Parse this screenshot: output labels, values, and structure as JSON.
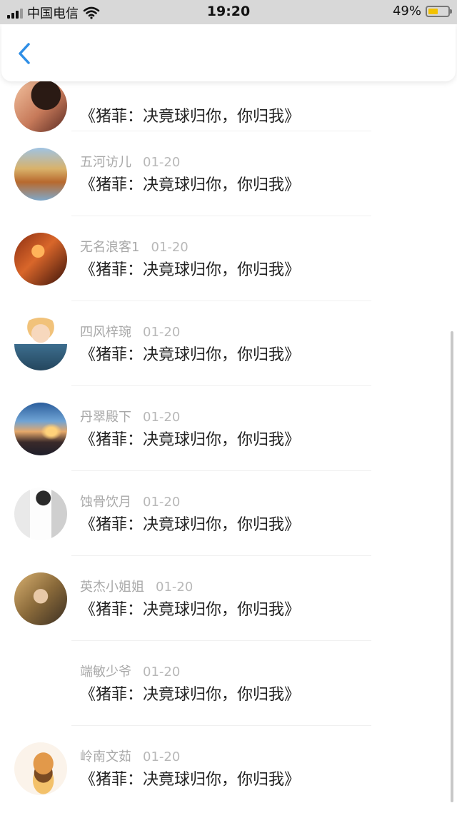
{
  "status_bar": {
    "carrier": "中国电信",
    "time": "19:20",
    "battery_percent": "49%",
    "battery_level": 0.49,
    "battery_color": "#f2c200"
  },
  "nav": {
    "back_icon": "chevron-left-icon",
    "accent": "#2e8ee6"
  },
  "comments": [
    {
      "user": "",
      "date": "",
      "text": "《猪菲：决竟球归你，你归我》"
    },
    {
      "user": "五河访儿",
      "date": "01-20",
      "text": "《猪菲：决竟球归你，你归我》"
    },
    {
      "user": "无名浪客1",
      "date": "01-20",
      "text": "《猪菲：决竟球归你，你归我》"
    },
    {
      "user": "四风梓琬",
      "date": "01-20",
      "text": "《猪菲：决竟球归你，你归我》"
    },
    {
      "user": "丹翠殿下",
      "date": "01-20",
      "text": "《猪菲：决竟球归你，你归我》"
    },
    {
      "user": "蚀骨饮月",
      "date": "01-20",
      "text": "《猪菲：决竟球归你，你归我》"
    },
    {
      "user": "英杰小姐姐",
      "date": "01-20",
      "text": "《猪菲：决竟球归你，你归我》"
    },
    {
      "user": "端敏少爷",
      "date": "01-20",
      "text": "《猪菲：决竟球归你，你归我》"
    },
    {
      "user": "岭南文茹",
      "date": "01-20",
      "text": "《猪菲：决竟球归你，你归我》"
    }
  ]
}
